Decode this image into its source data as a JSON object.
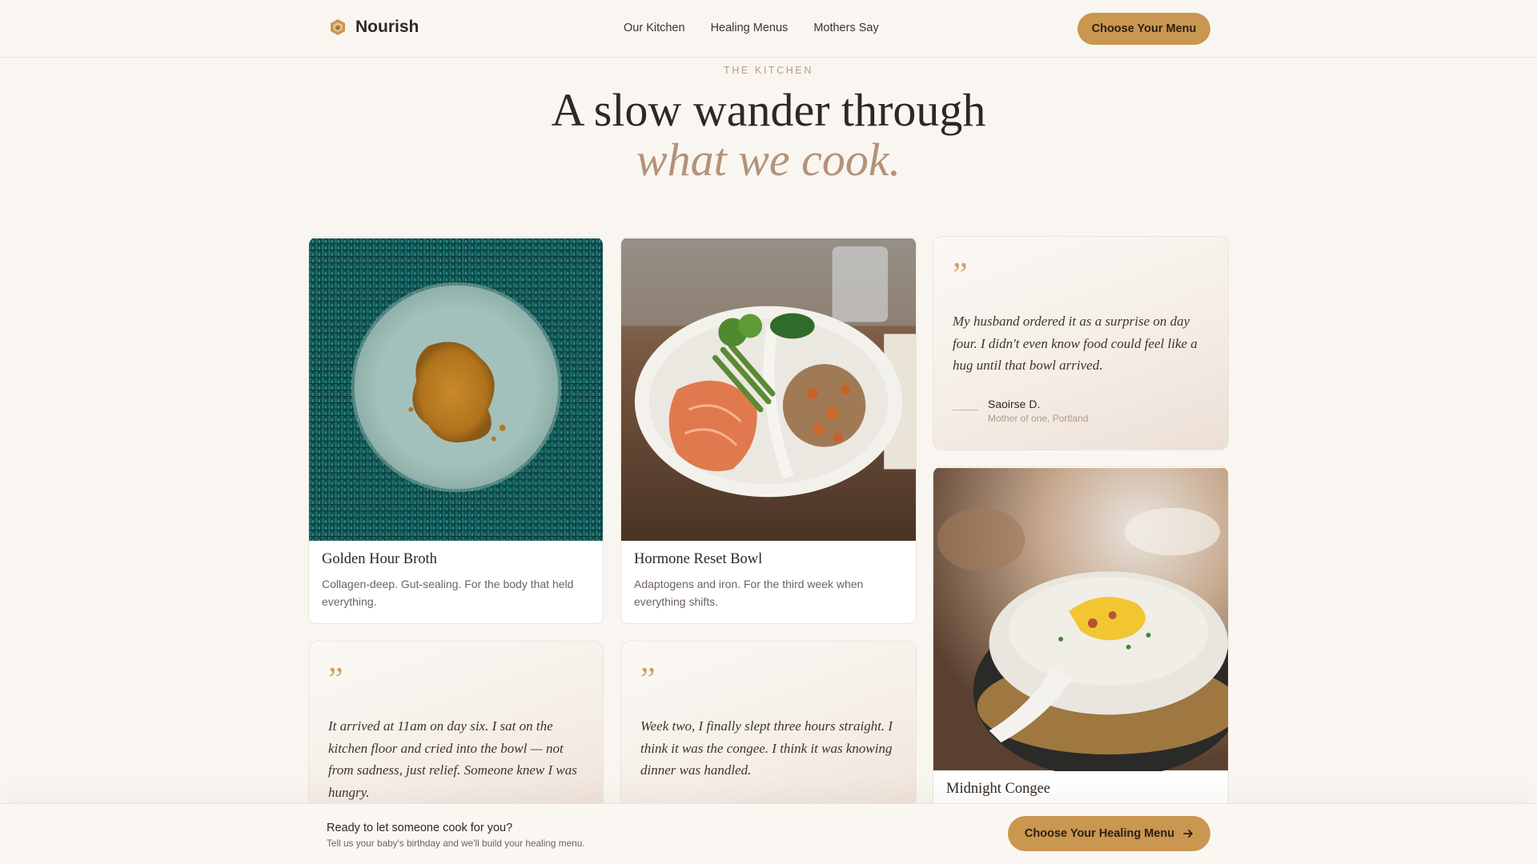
{
  "brand": {
    "name": "Nourish",
    "logo_icon": "hexagon-logo-icon"
  },
  "nav": {
    "items": [
      "Our Kitchen",
      "Healing Menus",
      "Mothers Say"
    ]
  },
  "header_cta": "Choose Your Menu",
  "hero": {
    "eyebrow": "THE KITCHEN",
    "title_line1": "A slow wander through",
    "title_line2": "what we cook."
  },
  "dishes": [
    {
      "title": "Golden Hour Broth",
      "desc": "Collagen-deep. Gut-sealing. For the body that held everything."
    },
    {
      "title": "Hormone Reset Bowl",
      "desc": "Adaptogens and iron. For the third week when everything shifts."
    },
    {
      "title": "Midnight Congee",
      "desc": ""
    }
  ],
  "testimonials": [
    {
      "mark": "”",
      "text": "My husband ordered it as a surprise on day four. I didn't even know food could feel like a hug until that bowl arrived.",
      "name": "Saoirse D.",
      "detail": "Mother of one, Portland"
    },
    {
      "mark": "”",
      "text": "It arrived at 11am on day six. I sat on the kitchen floor and cried into the bowl — not from sadness, just relief. Someone knew I was hungry."
    },
    {
      "mark": "”",
      "text": "Week two, I finally slept three hours straight. I think it was the congee. I think it was knowing dinner was handled."
    }
  ],
  "bottom_bar": {
    "title": "Ready to let someone cook for you?",
    "subtitle": "Tell us your baby's birthday and we'll build your healing menu.",
    "cta": "Choose Your Healing Menu",
    "cta_icon": "arrow-right-icon"
  },
  "colors": {
    "accent": "#c9974f",
    "background": "#f9f6f1",
    "muted_serif": "#b3927b"
  }
}
